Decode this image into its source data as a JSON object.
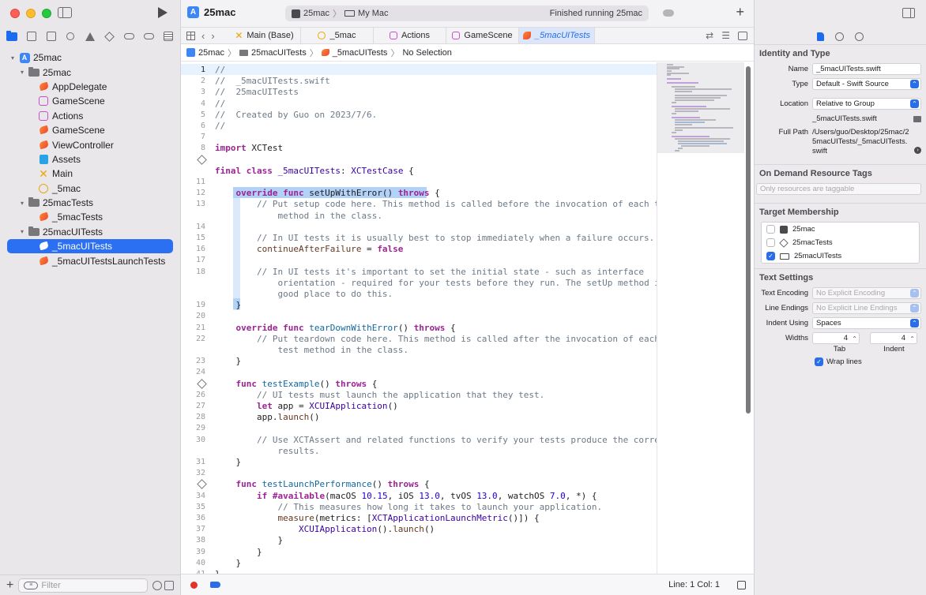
{
  "window": {
    "project_title": "25mac",
    "run_destination": {
      "scheme": "25mac",
      "device": "My Mac"
    },
    "status_text": "Finished running 25mac"
  },
  "navigator": {
    "tree": [
      {
        "label": "25mac",
        "type": "project",
        "indent": 0,
        "chevron": "▾"
      },
      {
        "label": "25mac",
        "type": "folder",
        "indent": 1,
        "chevron": "▾"
      },
      {
        "label": "AppDelegate",
        "type": "swift",
        "indent": 2
      },
      {
        "label": "GameScene",
        "type": "scene",
        "indent": 2
      },
      {
        "label": "Actions",
        "type": "scene",
        "indent": 2
      },
      {
        "label": "GameScene",
        "type": "swift",
        "indent": 2
      },
      {
        "label": "ViewController",
        "type": "swift",
        "indent": 2
      },
      {
        "label": "Assets",
        "type": "assets",
        "indent": 2
      },
      {
        "label": "Main",
        "type": "main",
        "indent": 2
      },
      {
        "label": "_5mac",
        "type": "mac",
        "indent": 2
      },
      {
        "label": "25macTests",
        "type": "folder",
        "indent": 1,
        "chevron": "▾"
      },
      {
        "label": "_5macTests",
        "type": "swift",
        "indent": 2
      },
      {
        "label": "25macUITests",
        "type": "folder",
        "indent": 1,
        "chevron": "▾"
      },
      {
        "label": "_5macUITests",
        "type": "swift",
        "indent": 2,
        "selected": true
      },
      {
        "label": "_5macUITestsLaunchTests",
        "type": "swift",
        "indent": 2
      }
    ],
    "filter_placeholder": "Filter"
  },
  "tabs": [
    {
      "label": "Main (Base)",
      "icon": "main"
    },
    {
      "label": "_5mac",
      "icon": "mac"
    },
    {
      "label": "Actions",
      "icon": "scene"
    },
    {
      "label": "GameScene",
      "icon": "scene"
    },
    {
      "label": "_5macUITests",
      "icon": "swift",
      "active": true
    }
  ],
  "jumpbar": {
    "project": "25mac",
    "group": "25macUITests",
    "file": "_5macUITests",
    "selection": "No Selection"
  },
  "code_lines": [
    {
      "n": "1",
      "html": "<span class='cmt'>//</span>"
    },
    {
      "n": "2",
      "html": "<span class='cmt'>//  _5macUITests.swift</span>"
    },
    {
      "n": "3",
      "html": "<span class='cmt'>//  25macUITests</span>"
    },
    {
      "n": "4",
      "html": "<span class='cmt'>//</span>"
    },
    {
      "n": "5",
      "html": "<span class='cmt'>//  Created by Guo on 2023/7/6.</span>"
    },
    {
      "n": "6",
      "html": "<span class='cmt'>//</span>"
    },
    {
      "n": "7",
      "html": ""
    },
    {
      "n": "8",
      "html": "<span class='kw'>import</span> XCTest"
    },
    {
      "n": "",
      "diamond": true,
      "html": ""
    },
    {
      "n": "",
      "html": "<span class='kw'>final class</span> <span class='ty'>_5macUITests</span>: <span class='ty'>XCTestCase</span> {"
    },
    {
      "n": "11",
      "html": ""
    },
    {
      "n": "12",
      "html": "    <span class='kw'>override func</span> setUpWithError() <span class='kw'>throws</span> {"
    },
    {
      "n": "13",
      "html": "        <span class='cmt'>// Put setup code here. This method is called before the invocation of each test</span>"
    },
    {
      "n": "",
      "html": "            <span class='cmt'>method in the class.</span>"
    },
    {
      "n": "14",
      "html": ""
    },
    {
      "n": "15",
      "html": "        <span class='cmt'>// In UI tests it is usually best to stop immediately when a failure occurs.</span>"
    },
    {
      "n": "16",
      "html": "        <span class='pr'>continueAfterFailure</span> = <span class='kw'>false</span>"
    },
    {
      "n": "17",
      "html": ""
    },
    {
      "n": "18",
      "html": "        <span class='cmt'>// In UI tests it's important to set the initial state - such as interface</span>"
    },
    {
      "n": "",
      "html": "            <span class='cmt'>orientation - required for your tests before they run. The setUp method is a</span>"
    },
    {
      "n": "",
      "html": "            <span class='cmt'>good place to do this.</span>"
    },
    {
      "n": "19",
      "html": "    }"
    },
    {
      "n": "20",
      "html": ""
    },
    {
      "n": "21",
      "html": "    <span class='kw'>override func</span> <span class='fn'>tearDownWithError</span>() <span class='kw'>throws</span> {"
    },
    {
      "n": "22",
      "html": "        <span class='cmt'>// Put teardown code here. This method is called after the invocation of each</span>"
    },
    {
      "n": "",
      "html": "            <span class='cmt'>test method in the class.</span>"
    },
    {
      "n": "23",
      "html": "    }"
    },
    {
      "n": "24",
      "html": ""
    },
    {
      "n": "",
      "diamond": true,
      "html": "    <span class='kw'>func</span> <span class='fn'>testExample</span>() <span class='kw'>throws</span> {"
    },
    {
      "n": "26",
      "html": "        <span class='cmt'>// UI tests must launch the application that they test.</span>"
    },
    {
      "n": "27",
      "html": "        <span class='kw'>let</span> app = <span class='ty'>XCUIApplication</span>()"
    },
    {
      "n": "28",
      "html": "        app.<span class='pr'>launch</span>()"
    },
    {
      "n": "29",
      "html": ""
    },
    {
      "n": "30",
      "html": "        <span class='cmt'>// Use XCTAssert and related functions to verify your tests produce the correct</span>"
    },
    {
      "n": "",
      "html": "            <span class='cmt'>results.</span>"
    },
    {
      "n": "31",
      "html": "    }"
    },
    {
      "n": "32",
      "html": ""
    },
    {
      "n": "",
      "diamond": true,
      "html": "    <span class='kw'>func</span> <span class='fn'>testLaunchPerformance</span>() <span class='kw'>throws</span> {"
    },
    {
      "n": "34",
      "html": "        <span class='kw'>if</span> <span class='kw'>#available</span>(macOS <span class='nm'>10.15</span>, iOS <span class='nm'>13.0</span>, tvOS <span class='nm'>13.0</span>, watchOS <span class='nm'>7.0</span>, *) {"
    },
    {
      "n": "35",
      "html": "            <span class='cmt'>// This measures how long it takes to launch your application.</span>"
    },
    {
      "n": "36",
      "html": "            <span class='pr'>measure</span>(metrics: [<span class='ty'>XCTApplicationLaunchMetric</span>()]) {"
    },
    {
      "n": "37",
      "html": "                <span class='ty'>XCUIApplication</span>().<span class='pr'>launch</span>()"
    },
    {
      "n": "38",
      "html": "            }"
    },
    {
      "n": "39",
      "html": "        }"
    },
    {
      "n": "40",
      "html": "    }"
    },
    {
      "n": "41",
      "html": "}"
    }
  ],
  "statusbar": {
    "position": "Line: 1  Col: 1"
  },
  "inspector": {
    "identity_title": "Identity and Type",
    "name_label": "Name",
    "name_value": "_5macUITests.swift",
    "type_label": "Type",
    "type_value": "Default - Swift Source",
    "location_label": "Location",
    "location_value": "Relative to Group",
    "location_file": "_5macUITests.swift",
    "fullpath_label": "Full Path",
    "fullpath_value": "/Users/guo/Desktop/25mac/25macUITests/_5macUITests.swift",
    "odr_title": "On Demand Resource Tags",
    "odr_placeholder": "Only resources are taggable",
    "membership_title": "Target Membership",
    "targets": [
      {
        "label": "25mac",
        "checked": false,
        "icon": "app"
      },
      {
        "label": "25macTests",
        "checked": false,
        "icon": "diamond"
      },
      {
        "label": "25macUITests",
        "checked": true,
        "icon": "mac"
      }
    ],
    "text_title": "Text Settings",
    "encoding_label": "Text Encoding",
    "encoding_value": "No Explicit Encoding",
    "endings_label": "Line Endings",
    "endings_value": "No Explicit Line Endings",
    "indent_label": "Indent Using",
    "indent_value": "Spaces",
    "widths_label": "Widths",
    "tab_width": "4",
    "indent_width": "4",
    "tab_caption": "Tab",
    "indent_caption": "Indent",
    "wrap_label": "Wrap lines"
  }
}
